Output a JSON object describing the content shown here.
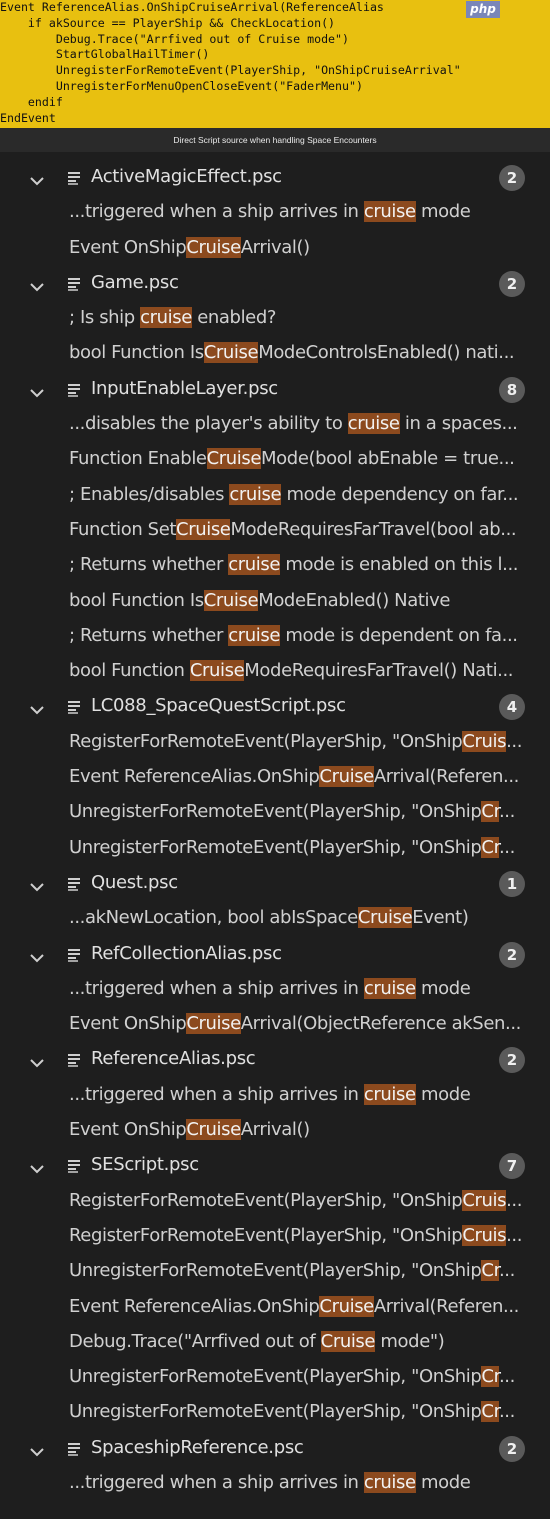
{
  "code_panel": {
    "lines": [
      "Event ReferenceAlias.OnShipCruiseArrival(ReferenceAlias",
      "    if akSource == PlayerShip && CheckLocation()",
      "        Debug.Trace(\"Arrfived out of Cruise mode\")",
      "        StartGlobalHailTimer()",
      "        UnregisterForRemoteEvent(PlayerShip, \"OnShipCruiseArrival\"",
      "        UnregisterForMenuOpenCloseEvent(\"FaderMenu\")",
      "    endif",
      "EndEvent"
    ],
    "badge": "php",
    "background": "#e8c010"
  },
  "caption": "Direct Script source when handling Space Encounters",
  "search_results": {
    "highlight_color": "#8c4a1e",
    "files": [
      {
        "name": "ActiveMagicEffect.psc",
        "count": "2",
        "matches": [
          [
            "...triggered when a ship arrives in ",
            "cruise",
            " mode"
          ],
          [
            "Event OnShip",
            "Cruise",
            "Arrival()"
          ]
        ]
      },
      {
        "name": "Game.psc",
        "count": "2",
        "matches": [
          [
            "; Is ship ",
            "cruise",
            " enabled?"
          ],
          [
            "bool Function Is",
            "Cruise",
            "ModeControlsEnabled() nati..."
          ]
        ]
      },
      {
        "name": "InputEnableLayer.psc",
        "count": "8",
        "matches": [
          [
            "...disables the player's ability to ",
            "cruise",
            " in a spaces..."
          ],
          [
            "Function Enable",
            "Cruise",
            "Mode(bool abEnable = true..."
          ],
          [
            "; Enables/disables ",
            "cruise",
            " mode dependency on far..."
          ],
          [
            "Function Set",
            "Cruise",
            "ModeRequiresFarTravel(bool ab..."
          ],
          [
            "; Returns whether ",
            "cruise",
            " mode is enabled on this l..."
          ],
          [
            "bool Function Is",
            "Cruise",
            "ModeEnabled() Native"
          ],
          [
            "; Returns whether ",
            "cruise",
            " mode is dependent on fa..."
          ],
          [
            "bool Function ",
            "Cruise",
            "ModeRequiresFarTravel() Nati..."
          ]
        ]
      },
      {
        "name": "LC088_SpaceQuestScript.psc",
        "count": "4",
        "matches": [
          [
            "RegisterForRemoteEvent(PlayerShip, \"OnShip",
            "Cruis",
            "..."
          ],
          [
            "Event ReferenceAlias.OnShip",
            "Cruise",
            "Arrival(Referen..."
          ],
          [
            "UnregisterForRemoteEvent(PlayerShip, \"OnShip",
            "Cr",
            "..."
          ],
          [
            "UnregisterForRemoteEvent(PlayerShip, \"OnShip",
            "Cr",
            "..."
          ]
        ]
      },
      {
        "name": "Quest.psc",
        "count": "1",
        "matches": [
          [
            "...akNewLocation, bool abIsSpace",
            "Cruise",
            "Event)"
          ]
        ]
      },
      {
        "name": "RefCollectionAlias.psc",
        "count": "2",
        "matches": [
          [
            "...triggered when a ship arrives in ",
            "cruise",
            " mode"
          ],
          [
            "Event OnShip",
            "Cruise",
            "Arrival(ObjectReference akSen..."
          ]
        ]
      },
      {
        "name": "ReferenceAlias.psc",
        "count": "2",
        "matches": [
          [
            "...triggered when a ship arrives in ",
            "cruise",
            " mode"
          ],
          [
            "Event OnShip",
            "Cruise",
            "Arrival()"
          ]
        ]
      },
      {
        "name": "SEScript.psc",
        "count": "7",
        "matches": [
          [
            "RegisterForRemoteEvent(PlayerShip, \"OnShip",
            "Cruis",
            "..."
          ],
          [
            "RegisterForRemoteEvent(PlayerShip, \"OnShip",
            "Cruis",
            "..."
          ],
          [
            "UnregisterForRemoteEvent(PlayerShip, \"OnShip",
            "Cr",
            "..."
          ],
          [
            "Event ReferenceAlias.OnShip",
            "Cruise",
            "Arrival(Referen..."
          ],
          [
            "Debug.Trace(\"Arrfived out of ",
            "Cruise",
            " mode\")"
          ],
          [
            "UnregisterForRemoteEvent(PlayerShip, \"OnShip",
            "Cr",
            "..."
          ],
          [
            "UnregisterForRemoteEvent(PlayerShip, \"OnShip",
            "Cr",
            "..."
          ]
        ]
      },
      {
        "name": "SpaceshipReference.psc",
        "count": "2",
        "matches": [
          [
            "...triggered when a ship arrives in ",
            "cruise",
            " mode"
          ]
        ]
      }
    ]
  },
  "icons": {
    "expand": "chevron-down-icon",
    "file": "file-lines-icon"
  }
}
